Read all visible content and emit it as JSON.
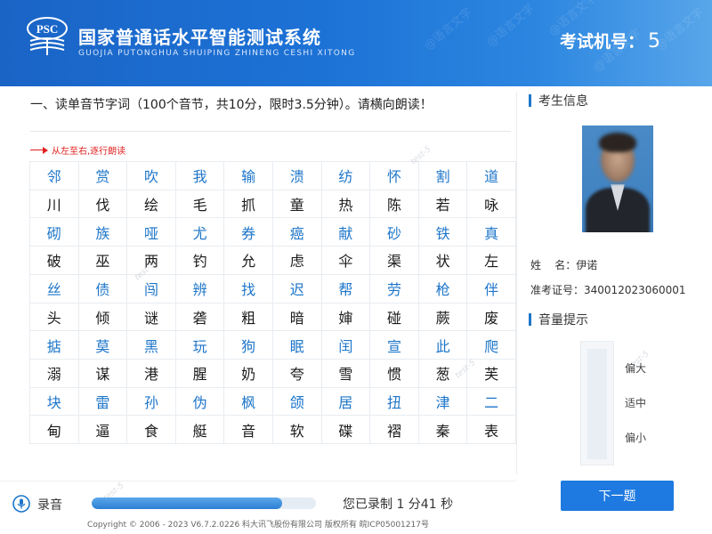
{
  "colors": {
    "header": "#1d72d6",
    "accent": "#1e76c9",
    "button": "#1e7ae0",
    "direction": "#e02020"
  },
  "header": {
    "logo_text": "PSC",
    "title": "国家普通话水平智能测试系统",
    "subtitle": "GUOJIA PUTONGHUA SHUIPING ZHINENG CESHI XITONG",
    "machine_label": "考试机号：",
    "machine_number": "5",
    "watermark": "@语言文字"
  },
  "main": {
    "instruction": "一、读单音节字词（100个音节，共10分，限时3.5分钟）。请横向朗读！",
    "direction": "从左至右,逐行朗读",
    "rows": [
      [
        "邻",
        "赏",
        "吹",
        "我",
        "输",
        "溃",
        "纺",
        "怀",
        "割",
        "道"
      ],
      [
        "川",
        "伐",
        "绘",
        "毛",
        "抓",
        "童",
        "热",
        "陈",
        "若",
        "咏"
      ],
      [
        "砌",
        "族",
        "哑",
        "尤",
        "券",
        "癌",
        "献",
        "砂",
        "铁",
        "真"
      ],
      [
        "破",
        "巫",
        "两",
        "钓",
        "允",
        "虑",
        "伞",
        "渠",
        "状",
        "左"
      ],
      [
        "丝",
        "债",
        "闯",
        "辨",
        "找",
        "迟",
        "帮",
        "劳",
        "枪",
        "伴"
      ],
      [
        "头",
        "倾",
        "谜",
        "砻",
        "粗",
        "暗",
        "婶",
        "碰",
        "蕨",
        "废"
      ],
      [
        "掂",
        "莫",
        "黑",
        "玩",
        "狗",
        "眠",
        "闰",
        "宣",
        "此",
        "爬"
      ],
      [
        "溺",
        "谋",
        "港",
        "腥",
        "奶",
        "夸",
        "雪",
        "惯",
        "葱",
        "芙"
      ],
      [
        "块",
        "雷",
        "孙",
        "伪",
        "枫",
        "颌",
        "居",
        "扭",
        "津",
        "二"
      ],
      [
        "甸",
        "逼",
        "食",
        "艇",
        "音",
        "软",
        "碟",
        "褶",
        "秦",
        "表"
      ]
    ]
  },
  "sidebar": {
    "candidate_title": "考生信息",
    "name_label": "姓    名：",
    "name_value": "伊诺",
    "id_label": "准考证号：",
    "id_value": "340012023060001",
    "volume_title": "音量提示",
    "volume_levels": [
      "偏大",
      "适中",
      "偏小"
    ]
  },
  "footer": {
    "record_label": "录音",
    "record_progress": 0.85,
    "record_status": "您已录制 1 分41 秒",
    "next_button": "下一题",
    "copyright": "Copyright © 2006 - 2023 V6.7.2.0226 科大讯飞股份有限公司 版权所有 皖ICP05001217号",
    "watermark": "test-5"
  }
}
